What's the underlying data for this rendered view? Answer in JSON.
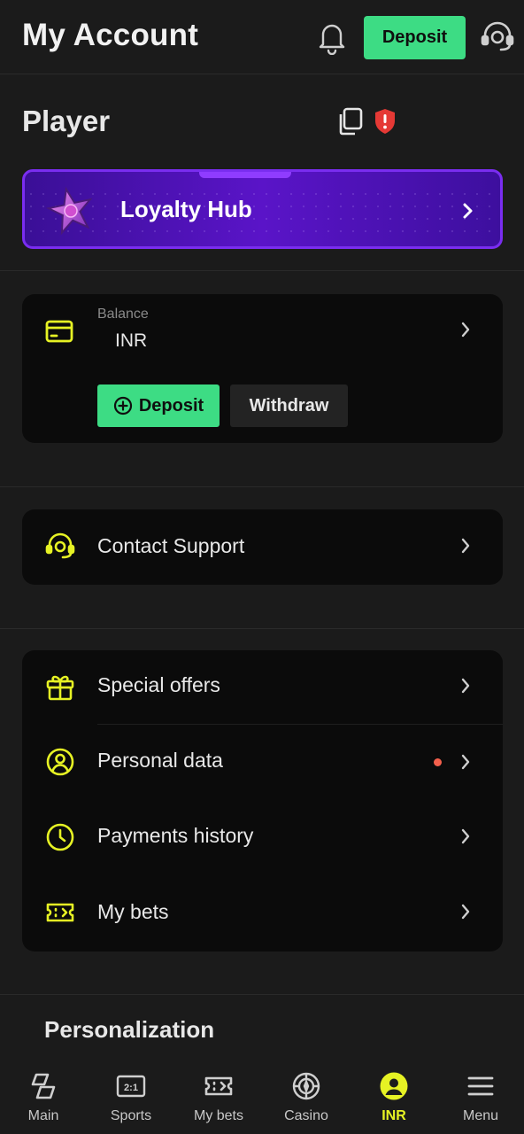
{
  "header": {
    "title": "My Account",
    "deposit_label": "Deposit",
    "icons": [
      "bell-icon",
      "headset-icon"
    ]
  },
  "player": {
    "name": "Player",
    "icons": [
      "copy-icon",
      "shield-alert-icon"
    ]
  },
  "loyalty": {
    "label": "Loyalty Hub",
    "icon": "star-icon"
  },
  "balance": {
    "label": "Balance",
    "currency": "INR",
    "deposit_label": "Deposit",
    "withdraw_label": "Withdraw"
  },
  "support": {
    "label": "Contact Support"
  },
  "menu": {
    "items": [
      {
        "label": "Special offers",
        "icon": "gift-icon",
        "notification": false
      },
      {
        "label": "Personal data",
        "icon": "user-circle-icon",
        "notification": true
      },
      {
        "label": "Payments history",
        "icon": "clock-icon",
        "notification": false
      },
      {
        "label": "My bets",
        "icon": "ticket-icon",
        "notification": false
      }
    ]
  },
  "personalization": {
    "heading": "Personalization"
  },
  "bottom_nav": {
    "items": [
      {
        "label": "Main",
        "icon": "main-icon"
      },
      {
        "label": "Sports",
        "icon": "scoreboard-icon"
      },
      {
        "label": "My bets",
        "icon": "ticket-icon"
      },
      {
        "label": "Casino",
        "icon": "chip-icon"
      },
      {
        "label": "INR",
        "icon": "user-circle-icon",
        "active": true
      },
      {
        "label": "Menu",
        "icon": "menu-icon"
      }
    ]
  },
  "colors": {
    "accent_green": "#3ddc84",
    "accent_yellow": "#e6f224",
    "loyalty_purple": "#5a14c8",
    "alert_red": "#f4604c",
    "background": "#1b1b1b",
    "card": "#0b0b0b"
  }
}
